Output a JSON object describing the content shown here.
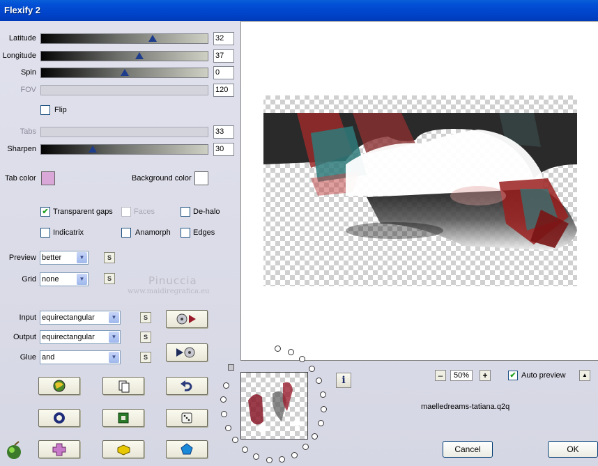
{
  "window": {
    "title": "Flexify 2"
  },
  "sliders": [
    {
      "label": "Latitude",
      "value": "32",
      "enabled": true,
      "level": 0.67
    },
    {
      "label": "Longitude",
      "value": "37",
      "enabled": true,
      "level": 0.59
    },
    {
      "label": "Spin",
      "value": "0",
      "enabled": true,
      "level": 0.5
    },
    {
      "label": "FOV",
      "value": "120",
      "enabled": false,
      "level": null
    },
    {
      "label": "Tabs",
      "value": "33",
      "enabled": false,
      "level": null
    },
    {
      "label": "Sharpen",
      "value": "30",
      "enabled": true,
      "level": 0.31
    }
  ],
  "flip": {
    "label": "Flip",
    "checked": false
  },
  "colors": {
    "tab_label": "Tab color",
    "tab_value": "#d9a8d9",
    "bg_label": "Background color",
    "bg_value": "#ffffff"
  },
  "options": {
    "transparent_gaps": {
      "label": "Transparent gaps",
      "checked": true
    },
    "faces": {
      "label": "Faces",
      "checked": false,
      "enabled": false
    },
    "dehalo": {
      "label": "De-halo",
      "checked": false
    },
    "indicatrix": {
      "label": "Indicatrix",
      "checked": false
    },
    "anamorph": {
      "label": "Anamorph",
      "checked": false
    },
    "edges": {
      "label": "Edges",
      "checked": false
    }
  },
  "selects": {
    "preview": {
      "label": "Preview",
      "value": "better"
    },
    "grid": {
      "label": "Grid",
      "value": "none"
    },
    "input": {
      "label": "Input",
      "value": "equirectangular"
    },
    "output": {
      "label": "Output",
      "value": "equirectangular"
    },
    "glue": {
      "label": "Glue",
      "value": "and"
    }
  },
  "small_button_glyph": "S",
  "watermark": {
    "line1": "Pinuccia",
    "line2": "www.maidiregrafica.eu"
  },
  "zoom": {
    "minus": "–",
    "value": "50%",
    "plus": "+"
  },
  "auto_preview": {
    "label": "Auto preview",
    "checked": true
  },
  "collapse_glyph": "▲",
  "filename": "maelledreams-tatiana.q2q",
  "info_glyph": "i",
  "buttons": {
    "cancel": "Cancel",
    "ok": "OK"
  },
  "accent_colors": {
    "thumb": "#1e3c8c",
    "title": "#0251d6",
    "red": "#b01820",
    "teal": "#2f7a7a"
  }
}
